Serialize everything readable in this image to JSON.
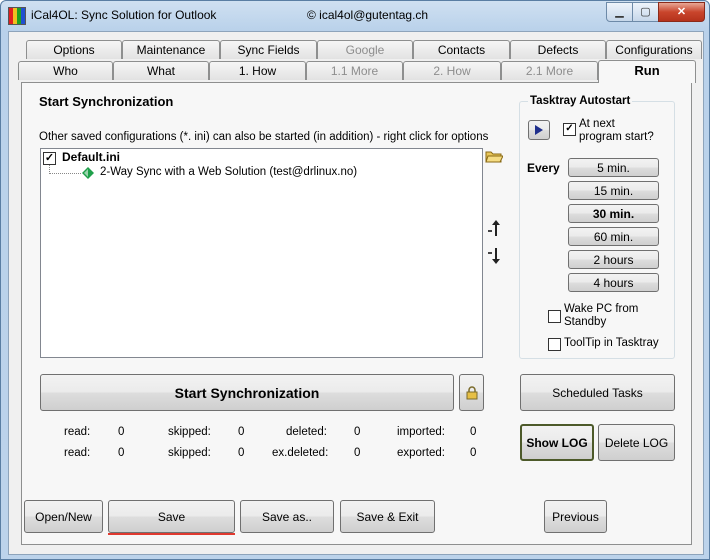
{
  "window": {
    "title": "iCal4OL: Sync Solution for Outlook",
    "email": "© ical4ol@gutentag.ch",
    "minimize_glyph": "▁",
    "maximize_glyph": "▢",
    "close_glyph": "✕"
  },
  "tabs_row1": [
    {
      "label": "Options",
      "disabled": false
    },
    {
      "label": "Maintenance",
      "disabled": false
    },
    {
      "label": "Sync Fields",
      "disabled": false
    },
    {
      "label": "Google",
      "disabled": true
    },
    {
      "label": "Contacts",
      "disabled": false
    },
    {
      "label": "Defects",
      "disabled": false
    },
    {
      "label": "Configurations",
      "disabled": false
    }
  ],
  "tabs_row2": [
    {
      "label": "Who",
      "disabled": false
    },
    {
      "label": "What",
      "disabled": false
    },
    {
      "label": "1. How",
      "disabled": false
    },
    {
      "label": "1.1 More",
      "disabled": true
    },
    {
      "label": "2. How",
      "disabled": true
    },
    {
      "label": "2.1 More",
      "disabled": true
    },
    {
      "label": "Run",
      "disabled": false,
      "active": true
    }
  ],
  "main": {
    "heading": "Start Synchronization",
    "hint": "Other saved configurations (*. ini) can also be started (in addition) - right click for options",
    "tree": {
      "root_label": "Default.ini",
      "root_checked": true,
      "child_label": "2-Way Sync with a Web Solution (test@drlinux.no)"
    },
    "start_button": "Start Synchronization",
    "stats": [
      {
        "read_label": "read:",
        "read": "0",
        "skipped_label": "skipped:",
        "skipped": "0",
        "deleted_label": "deleted:",
        "deleted": "0",
        "io_label": "imported:",
        "io": "0"
      },
      {
        "read_label": "read:",
        "read": "0",
        "skipped_label": "skipped:",
        "skipped": "0",
        "deleted_label": "ex.deleted:",
        "deleted": "0",
        "io_label": "exported:",
        "io": "0"
      }
    ]
  },
  "tasktray": {
    "heading": "Tasktray Autostart",
    "at_next_label": "At next program start?",
    "at_next_checked": true,
    "every_label": "Every",
    "intervals": [
      "5 min.",
      "15 min.",
      "30 min.",
      "60 min.",
      "2 hours",
      "4 hours"
    ],
    "selected_interval": "30 min.",
    "wake_label": "Wake PC from Standby",
    "tooltip_label": "ToolTip in Tasktray"
  },
  "right_buttons": {
    "scheduled": "Scheduled Tasks",
    "show_log": "Show LOG",
    "delete_log": "Delete LOG"
  },
  "bottom_buttons": {
    "open_new": "Open/New",
    "save": "Save",
    "save_as": "Save as..",
    "save_exit": "Save & Exit",
    "previous": "Previous"
  },
  "colors": {
    "active_underline": "#e0392f",
    "blue_arrow": "#1f2f8c",
    "green_diamond": "#1fa04a"
  }
}
